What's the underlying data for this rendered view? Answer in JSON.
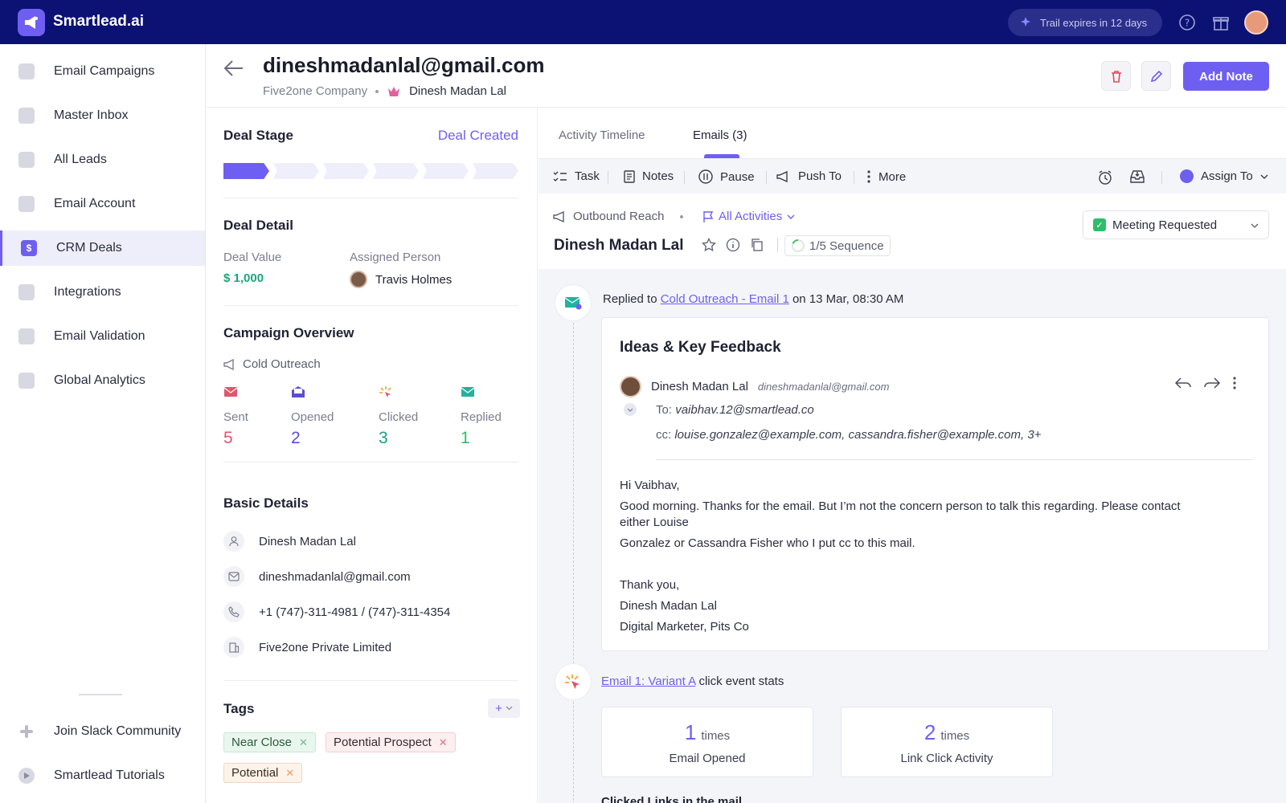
{
  "app": {
    "brand": "Smartlead.ai",
    "trial": "Trail expires in 12 days"
  },
  "sidebar": {
    "items": [
      {
        "label": "Email Campaigns"
      },
      {
        "label": "Master Inbox"
      },
      {
        "label": "All Leads"
      },
      {
        "label": "Email Account"
      },
      {
        "label": "CRM Deals",
        "icon_text": "$"
      },
      {
        "label": "Integrations"
      },
      {
        "label": "Email Validation"
      },
      {
        "label": "Global Analytics"
      }
    ],
    "bottom": [
      {
        "label": "Join Slack Community"
      },
      {
        "label": "Smartlead Tutorials"
      }
    ]
  },
  "header": {
    "email": "dineshmadanlal@gmail.com",
    "company": "Five2one Company",
    "person": "Dinesh Madan Lal",
    "add_note": "Add Note"
  },
  "deal": {
    "stage_title": "Deal Stage",
    "stage_value": "Deal Created",
    "detail_title": "Deal Detail",
    "value_label": "Deal Value",
    "value": "$ 1,000",
    "assigned_label": "Assigned Person",
    "assigned": "Travis Holmes",
    "campaign_title": "Campaign Overview",
    "campaign_name": "Cold Outreach",
    "stats": [
      {
        "label": "Sent",
        "value": "5",
        "color": "#e0566d"
      },
      {
        "label": "Opened",
        "value": "2",
        "color": "#5b4fd1"
      },
      {
        "label": "Clicked",
        "value": "3",
        "color": "#1a9e8a"
      },
      {
        "label": "Replied",
        "value": "1",
        "color": "#2ebd6b"
      }
    ],
    "basic_title": "Basic Details",
    "basic": {
      "name": "Dinesh Madan Lal",
      "email": "dineshmadanlal@gmail.com",
      "phone": "+1 (747)-311-4981 / (747)-311-4354",
      "company": "Five2one Private Limited"
    },
    "tags_title": "Tags",
    "tags": [
      "Near Close",
      "Potential Prospect",
      "Potential"
    ]
  },
  "tabs": [
    "Activity Timeline",
    "Emails (3)"
  ],
  "toolbar": {
    "task": "Task",
    "notes": "Notes",
    "pause": "Pause",
    "push": "Push To",
    "more": "More",
    "assign": "Assign To"
  },
  "lead": {
    "source": "Outbound Reach",
    "filter": "All Activities",
    "name": "Dinesh Madan Lal",
    "sequence": "1/5 Sequence",
    "status": "Meeting Requested"
  },
  "timeline": {
    "reply_prefix": "Replied to",
    "reply_link": "Cold Outreach - Email 1",
    "reply_suffix": "on 13 Mar, 08:30 AM",
    "email": {
      "subject": "Ideas & Key Feedback",
      "from_name": "Dinesh Madan Lal",
      "from_addr": "dineshmadanlal@gmail.com",
      "to_label": "To:",
      "to": "vaibhav.12@smartlead.co",
      "cc_label": "cc:",
      "cc": "louise.gonzalez@example.com, cassandra.fisher@example.com, 3+",
      "body": [
        "Hi Vaibhav,",
        "Good morning. Thanks for the email. But I’m not the concern person to talk this regarding. Please contact either Louise",
        "Gonzalez or Cassandra Fisher who I put cc to this mail.",
        "Thank you,",
        "Dinesh Madan Lal",
        "Digital Marketer, Pits Co"
      ]
    },
    "click_link": "Email 1: Variant A",
    "click_suffix": "click event stats",
    "click_stats": [
      {
        "num": "1",
        "unit": "times",
        "label": "Email Opened"
      },
      {
        "num": "2",
        "unit": "times",
        "label": "Link Click Activity"
      }
    ],
    "clicked_links_title": "Clicked Links in the mail"
  },
  "colors": {
    "accent": "#6e5ff2",
    "topbar": "#0c1274"
  }
}
